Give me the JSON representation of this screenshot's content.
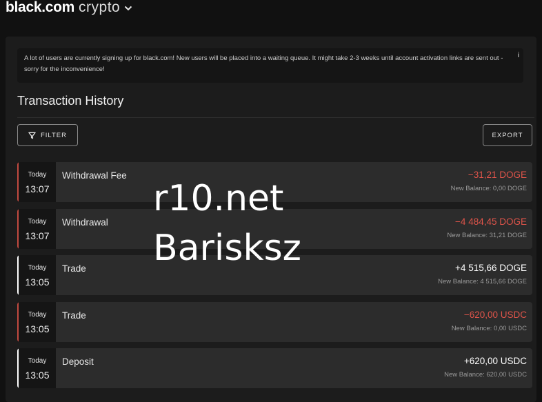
{
  "header": {
    "brand_main": "black.com",
    "brand_sub": "crypto"
  },
  "notice": {
    "text": "A lot of users are currently signing up for black.com! New users will be placed into a waiting queue. It might take 2-3 weeks until account activation links are sent out - sorry for the inconvenience!",
    "info_glyph": "i"
  },
  "page": {
    "title": "Transaction History",
    "filter_label": "FILTER",
    "export_label": "EXPORT"
  },
  "colors": {
    "negative": "#e0544a",
    "positive": "#ffffff",
    "accent_negative": "#c24a40",
    "accent_positive": "#ffffff"
  },
  "transactions": [
    {
      "day": "Today",
      "time": "13:07",
      "label": "Withdrawal Fee",
      "amount": "−31,21 DOGE",
      "balance": "New Balance: 0,00 DOGE",
      "direction": "negative"
    },
    {
      "day": "Today",
      "time": "13:07",
      "label": "Withdrawal",
      "amount": "−4 484,45 DOGE",
      "balance": "New Balance: 31,21 DOGE",
      "direction": "negative"
    },
    {
      "day": "Today",
      "time": "13:05",
      "label": "Trade",
      "amount": "+4 515,66 DOGE",
      "balance": "New Balance: 4 515,66 DOGE",
      "direction": "positive"
    },
    {
      "day": "Today",
      "time": "13:05",
      "label": "Trade",
      "amount": "−620,00 USDC",
      "balance": "New Balance: 0,00 USDC",
      "direction": "negative"
    },
    {
      "day": "Today",
      "time": "13:05",
      "label": "Deposit",
      "amount": "+620,00 USDC",
      "balance": "New Balance: 620,00 USDC",
      "direction": "positive"
    }
  ],
  "watermark": {
    "line1": "r10.net",
    "line2": "Barisksz"
  }
}
